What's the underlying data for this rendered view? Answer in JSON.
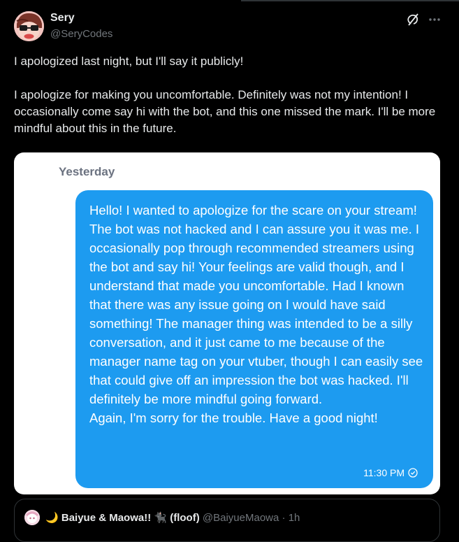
{
  "author": {
    "name": "Sery",
    "handle": "@SeryCodes"
  },
  "post": {
    "paragraph1": "I apologized last night, but I'll say it publicly!",
    "paragraph2": "I apologize for making you uncomfortable. Definitely was not my intention! I occasionally come say hi with the bot, and this one missed the mark. I'll be more mindful about this in the future."
  },
  "screenshot": {
    "day_label": "Yesterday",
    "message": "Hello! I wanted to apologize for the scare on your stream! The bot was not hacked and I can assure you it was me. I occasionally pop through recommended streamers using the bot and say hi! Your feelings are valid though, and I understand that made you uncomfortable. Had I known that there was any issue going on I would have said something! The manager thing was intended to be a silly conversation, and it just came to me because of the manager name tag on your vtuber, though I can easily see that could give off an impression the bot was hacked. I'll definitely be more mindful going forward.\nAgain, I'm sorry for the trouble. Have a good night!",
    "time": "11:30 PM"
  },
  "quoted": {
    "name_prefix": "🌙",
    "name": "Baiyue & Maowa!!",
    "name_suffix": "🐈‍⬛ (floof)",
    "handle": "@BaiyueMaowa",
    "separator": "·",
    "age": "1h"
  },
  "icons": {
    "grok": "grok-icon",
    "more": "more-icon",
    "read_receipt": "check-circle-icon"
  },
  "colors": {
    "bubble": "#1d9bf0",
    "background": "#000000",
    "secondary_text": "#71767b"
  }
}
